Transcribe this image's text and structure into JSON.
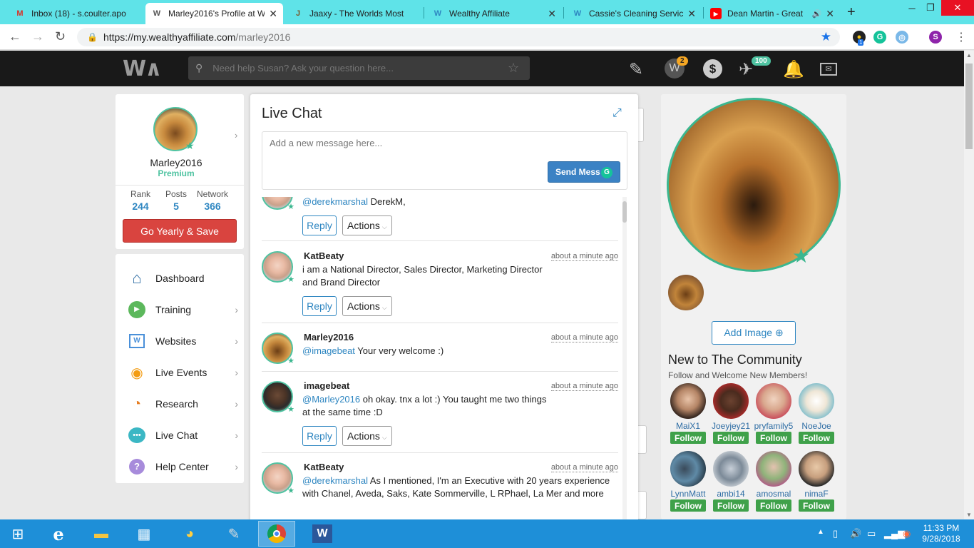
{
  "browser": {
    "tabs": [
      {
        "title": "Inbox (18) - s.coulter.apo",
        "icon": "gmail-icon",
        "active": false
      },
      {
        "title": "Marley2016's Profile at W",
        "icon": "wa-icon",
        "active": true
      },
      {
        "title": "Jaaxy - The Worlds Most",
        "icon": "jaaxy-icon",
        "active": false
      },
      {
        "title": "Wealthy Affiliate",
        "icon": "wa-icon",
        "active": false
      },
      {
        "title": "Cassie's Cleaning Service",
        "icon": "wa-icon",
        "active": false
      },
      {
        "title": "Dean Martin - Great",
        "icon": "youtube-icon",
        "active": false
      }
    ],
    "url_host": "https://my.wealthyaffiliate.com",
    "url_path": "/marley2016",
    "profile_initial": "S",
    "ext_badge": "1"
  },
  "header": {
    "logo": "W∧",
    "search_placeholder": "Need help Susan? Ask your question here...",
    "badge_wa": "2",
    "badge_plane": "100"
  },
  "profile": {
    "username": "Marley2016",
    "tier": "Premium",
    "stats": [
      {
        "label": "Rank",
        "value": "244"
      },
      {
        "label": "Posts",
        "value": "5"
      },
      {
        "label": "Network",
        "value": "366"
      }
    ],
    "cta": "Go Yearly & Save"
  },
  "nav": [
    {
      "label": "Dashboard",
      "icon": "home-icon"
    },
    {
      "label": "Training",
      "icon": "play-icon"
    },
    {
      "label": "Websites",
      "icon": "websites-icon"
    },
    {
      "label": "Live Events",
      "icon": "broadcast-icon"
    },
    {
      "label": "Research",
      "icon": "research-icon"
    },
    {
      "label": "Live Chat",
      "icon": "chat-icon"
    },
    {
      "label": "Help Center",
      "icon": "help-icon"
    }
  ],
  "chat": {
    "title": "Live Chat",
    "input_placeholder": "Add a new message here...",
    "send_label": "Send Mess",
    "reply_label": "Reply",
    "actions_label": "Actions",
    "messages": [
      {
        "user": "",
        "time": "",
        "mention": "@derekmarshal",
        "text": " DerekM,"
      },
      {
        "user": "KatBeaty",
        "time": "about a minute ago",
        "mention": "",
        "text": "i am a National Director, Sales Director, Marketing Director and Brand Director"
      },
      {
        "user": "Marley2016",
        "time": "about a minute ago",
        "mention": "@imagebeat",
        "text": " Your very welcome :)"
      },
      {
        "user": "imagebeat",
        "time": "about a minute ago",
        "mention": "@Marley2016",
        "text": " oh okay. tnx a lot :) You taught me two things at the same time :D"
      },
      {
        "user": "KatBeaty",
        "time": "about a minute ago",
        "mention": "@derekmarshal",
        "text": " As I mentioned, I'm an Executive with 20 years experience with Chanel, Aveda, Saks, Kate Sommerville, L RPhael, La Mer and more"
      }
    ]
  },
  "right": {
    "add_image_label": "Add Image",
    "community_title": "New to The Community",
    "community_subtitle": "Follow and Welcome New Members!",
    "follow_label": "Follow",
    "members": [
      "MaiX1",
      "Joeyjey21",
      "pryfamily5",
      "NoeJoe",
      "LynnMatt",
      "ambi14",
      "amosmal",
      "nimaF"
    ]
  },
  "taskbar": {
    "time": "11:33 PM",
    "date": "9/28/2018"
  },
  "colors": {
    "tab_strip": "#5fe3e8",
    "accent_green": "#4fc3a1",
    "link_blue": "#2e86c1",
    "cta_red": "#d9443f",
    "follow_green": "#3fa14a",
    "taskbar": "#1e8fd8"
  }
}
